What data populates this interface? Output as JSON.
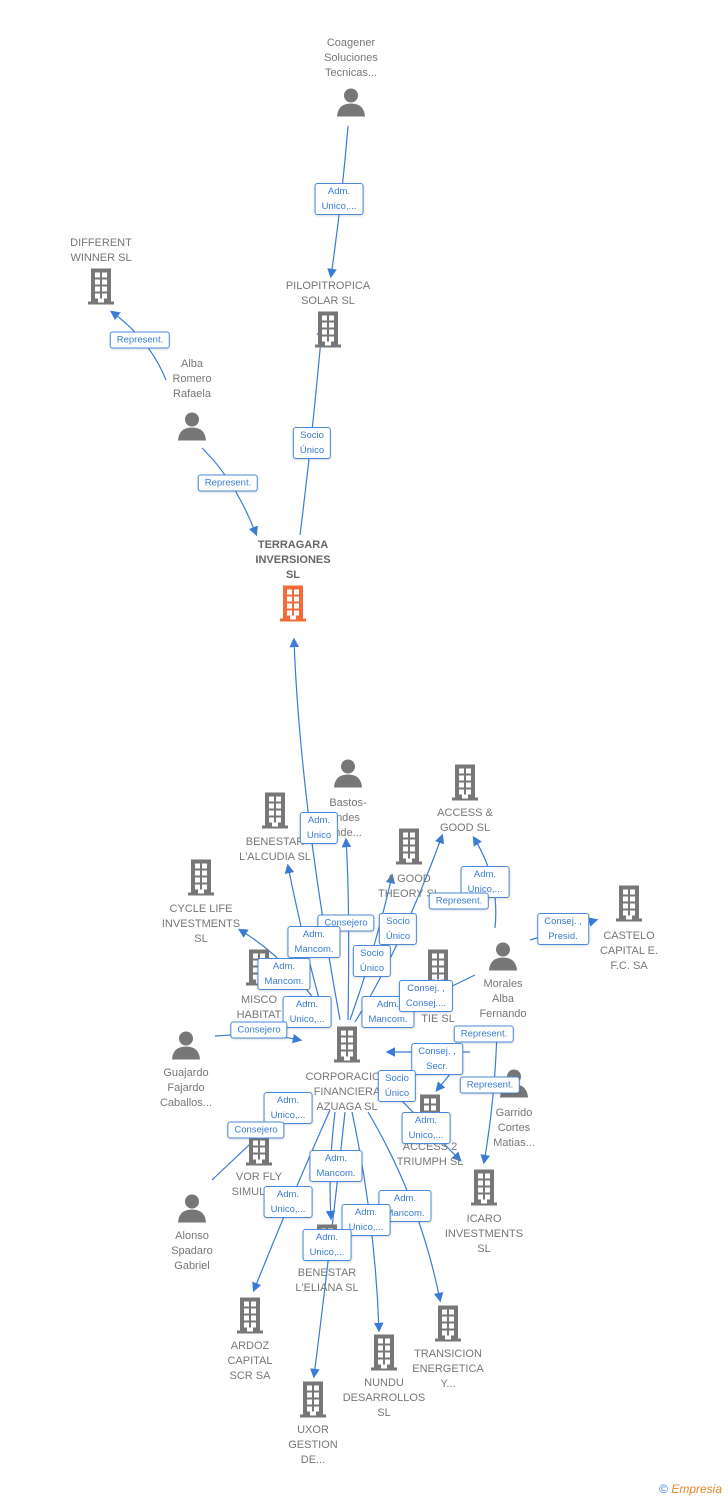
{
  "nodes": [
    {
      "id": "coagener",
      "type": "person",
      "label": "Coagener\nSoluciones\nTecnicas..."
    },
    {
      "id": "pilopitropica",
      "type": "company",
      "label": "PILOPITROPICA\nSOLAR  SL"
    },
    {
      "id": "different",
      "type": "company",
      "label": "DIFFERENT\nWINNER  SL"
    },
    {
      "id": "alba",
      "type": "person",
      "label": "Alba\nRomero\nRafaela"
    },
    {
      "id": "terragara",
      "type": "main-company",
      "label": "TERRAGARA\nINVERSIONES\nSL"
    },
    {
      "id": "bastos",
      "type": "person",
      "label": "Bastos-\nndes\nnde..."
    },
    {
      "id": "alcudia",
      "type": "company",
      "label": "BENESTAR\nL'ALCUDIA  SL"
    },
    {
      "id": "accessgood",
      "type": "company",
      "label": "ACCESS &\nGOOD  SL"
    },
    {
      "id": "agood",
      "type": "company",
      "label": "A GOOD\nTHEORY  SL"
    },
    {
      "id": "cycle",
      "type": "company",
      "label": "CYCLE LIFE\nINVESTMENTS\nSL"
    },
    {
      "id": "castelo",
      "type": "company",
      "label": "CASTELO\nCAPITAL E.\nF.C. SA"
    },
    {
      "id": "misco",
      "type": "company",
      "label": "MISCO\nHABITAT"
    },
    {
      "id": "morales",
      "type": "person",
      "label": "Morales\nAlba\nFernando"
    },
    {
      "id": "entie",
      "type": "company",
      "label": "EN\nTIE  SL"
    },
    {
      "id": "guajardo",
      "type": "person",
      "label": "Guajardo\nFajardo\nCaballos..."
    },
    {
      "id": "corporacion",
      "type": "company",
      "label": "CORPORACION\nFINANCIERA\nAZUAGA  SL"
    },
    {
      "id": "garrido",
      "type": "person",
      "label": "Garrido\nCortes\nMatias..."
    },
    {
      "id": "access2",
      "type": "company",
      "label": "ACCESS 2\nTRIUMPH  SL"
    },
    {
      "id": "vorfly",
      "type": "company",
      "label": "VOR FLY\nSIMULAT..."
    },
    {
      "id": "icaro",
      "type": "company",
      "label": "ICARO\nINVESTMENTS\nSL"
    },
    {
      "id": "alonso",
      "type": "person",
      "label": "Alonso\nSpadaro\nGabriel"
    },
    {
      "id": "eliana",
      "type": "company",
      "label": "BENESTAR\nL'ELIANA  SL"
    },
    {
      "id": "ardoz",
      "type": "company",
      "label": "ARDOZ\nCAPITAL\nSCR SA"
    },
    {
      "id": "nundu",
      "type": "company",
      "label": "NUNDU\nDESARROLLOS\nSL"
    },
    {
      "id": "transicion",
      "type": "company",
      "label": "TRANSICION\nENERGETICA\nY..."
    },
    {
      "id": "uxor",
      "type": "company",
      "label": "UXOR\nGESTION\nDE..."
    }
  ],
  "edge_labels": [
    "Adm.\nUnico,...",
    "Represent.",
    "Represent.",
    "Socio\nÚnico",
    "Adm.\nUnico",
    "Consejero",
    "Socio\nÚnico",
    "Adm.\nMancom.",
    "Socio\nÚnico",
    "Adm.\nMancom.",
    "Adm.\nUnico,...",
    "Consejero",
    "Adm.\nMancom.",
    "Consej. ,\nConsej....",
    "Adm.\nUnico,...",
    "Represent.",
    "Consej. ,\nPresid.",
    "Represent.",
    "Consej. ,\nSecr.",
    "Socio\nÚnico",
    "Represent.",
    "Adm.\nUnico,...",
    "Adm.\nUnico,...",
    "Consejero",
    "Adm.\nMancom.",
    "Adm.\nUnico,...",
    "Adm.\nMancom.",
    "Adm.\nUnico,...",
    "Adm.\nUnico,..."
  ],
  "colors": {
    "main": "#f26b38",
    "node": "#777777",
    "edge": "#3a7bd5"
  },
  "footer": {
    "copyright": "©",
    "brand": "Empresia"
  }
}
